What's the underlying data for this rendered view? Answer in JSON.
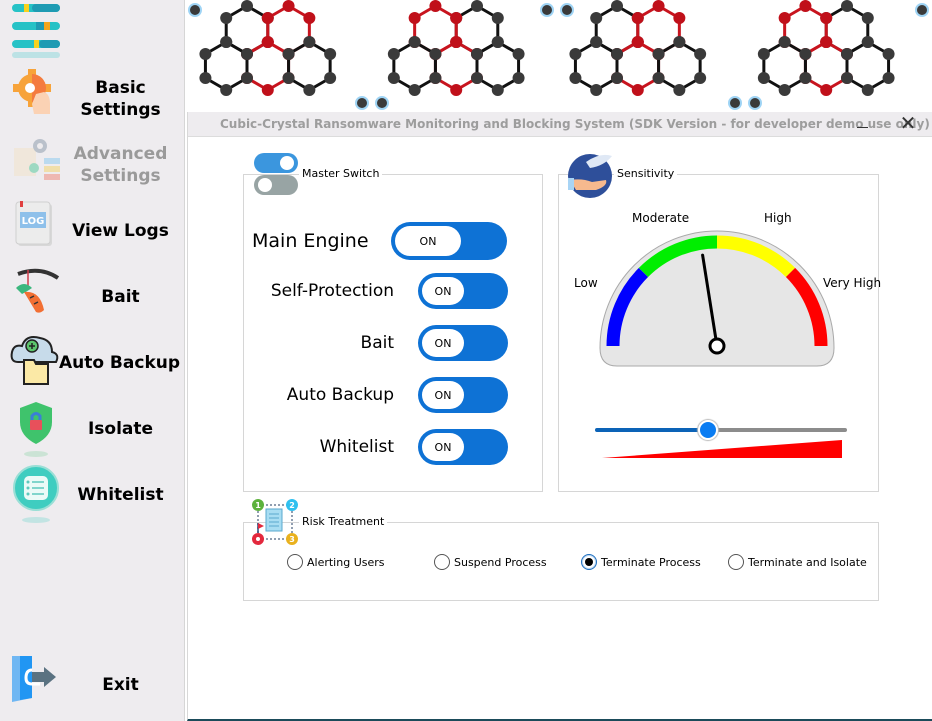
{
  "sidebar": {
    "items": [
      {
        "label": "Basic Settings",
        "icon": "settings-gear-hand-icon",
        "enabled": true
      },
      {
        "label": "Advanced Settings",
        "icon": "advanced-settings-icon",
        "enabled": false
      },
      {
        "label": "View Logs",
        "icon": "log-file-icon",
        "enabled": true
      },
      {
        "label": "Bait",
        "icon": "carrot-bait-icon",
        "enabled": true
      },
      {
        "label": "Auto Backup",
        "icon": "cloud-backup-icon",
        "enabled": true
      },
      {
        "label": "Isolate",
        "icon": "shield-lock-icon",
        "enabled": true
      },
      {
        "label": "Whitelist",
        "icon": "checklist-icon",
        "enabled": true
      }
    ],
    "exit_label": "Exit"
  },
  "window": {
    "title": "Cubic-Crystal Ransomware Monitoring and Blocking System (SDK Version - for developer demo use only)",
    "minimize_glyph": "—",
    "close_glyph": "✕"
  },
  "master_switch": {
    "title": "Master Switch",
    "rows": [
      {
        "label": "Main Engine",
        "state": "ON"
      },
      {
        "label": "Self-Protection",
        "state": "ON"
      },
      {
        "label": "Bait",
        "state": "ON"
      },
      {
        "label": "Auto Backup",
        "state": "ON"
      },
      {
        "label": "Whitelist",
        "state": "ON"
      }
    ]
  },
  "sensitivity": {
    "title": "Sensitivity",
    "levels": [
      "Low",
      "Moderate",
      "High",
      "Very High"
    ],
    "level_colors": [
      "#0000ff",
      "#00ee00",
      "#ffff00",
      "#ff0000"
    ],
    "value_fraction": 0.45
  },
  "risk_treatment": {
    "title": "Risk Treatment",
    "options": [
      {
        "label": "Alerting Users",
        "checked": false
      },
      {
        "label": "Suspend Process",
        "checked": false
      },
      {
        "label": "Terminate Process",
        "checked": true
      },
      {
        "label": "Terminate and Isolate",
        "checked": false
      }
    ]
  }
}
